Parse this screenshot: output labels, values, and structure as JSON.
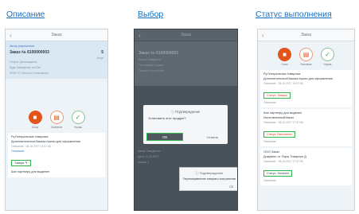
{
  "titles": {
    "col1": "Описание",
    "col2": "Выбор",
    "col3": "Статус выполнения"
  },
  "phone1": {
    "header_title": "Заказ",
    "info_label": "Автор разрешения",
    "order_label": "Заказ № 6100000003",
    "qty": "5",
    "qty_unit": "Штук",
    "lines": [
      "Нитрат Диоксиданта",
      "Куда Заведение из 50м",
      "3026 TO Электро Устанавлен"
    ],
    "tabs": [
      "Отказ",
      "Описание",
      "Норма"
    ],
    "card": {
      "title": "Ру.Генеральные товарные",
      "desc": "Дополнительные/Заказа нужны для оформления",
      "meta": "Описание · 08.10.2017 14:07:06",
      "link": "Описание",
      "status_box": "Товары",
      "footer": "Шаг партнеру для выделен"
    }
  },
  "phone2": {
    "header_title": "Заказ",
    "order_label": "Заказ № 6100000003",
    "lines": [
      "Заказ Заведение",
      "Поставщик Сервис",
      "Текущее состояние"
    ],
    "dialog1": {
      "title": "Подтверждение",
      "question": "Установить этот продукт?",
      "ok": "ОК",
      "cancel": "Отмена"
    },
    "dialog2": {
      "title": "Подтверждение",
      "text": "Перенаправление товаров к получателям",
      "ok": "ОК"
    },
    "card_lines": [
      "Заказ Заведение",
      "Дата 11.02.2017",
      "Норма 2"
    ]
  },
  "phone3": {
    "header_title": "Заказ",
    "tabs": [
      "Отказ",
      "Описание",
      "Норма"
    ],
    "cards": [
      {
        "title": "Ру.Генеральные товарные",
        "desc": "Дополнительные/Заказа нужны для оформления",
        "meta": "Описание · 08.10.2017 14:07:06",
        "status": "Статус: Товары",
        "status_red": true,
        "footer": "Описание"
      },
      {
        "title": "Шаг партнеру для выделен",
        "desc": "Изготовленный/Заказ",
        "meta": "Описание · 08.10.2017 17:07:06",
        "status": "Статус: Выполнено",
        "status_red": true,
        "footer": "Описание"
      },
      {
        "title": "ООО Заказ",
        "desc": "Документ от Пары Товарное Д",
        "meta": "Описание · 08.10.2017 17:07:05",
        "status": "Статус: Оплачен",
        "status_red": false,
        "footer": "Описание"
      }
    ]
  },
  "colors": {
    "accent_orange": "#e2541a",
    "highlight_green": "#2fb34a",
    "link_blue": "#1a6fc0"
  }
}
